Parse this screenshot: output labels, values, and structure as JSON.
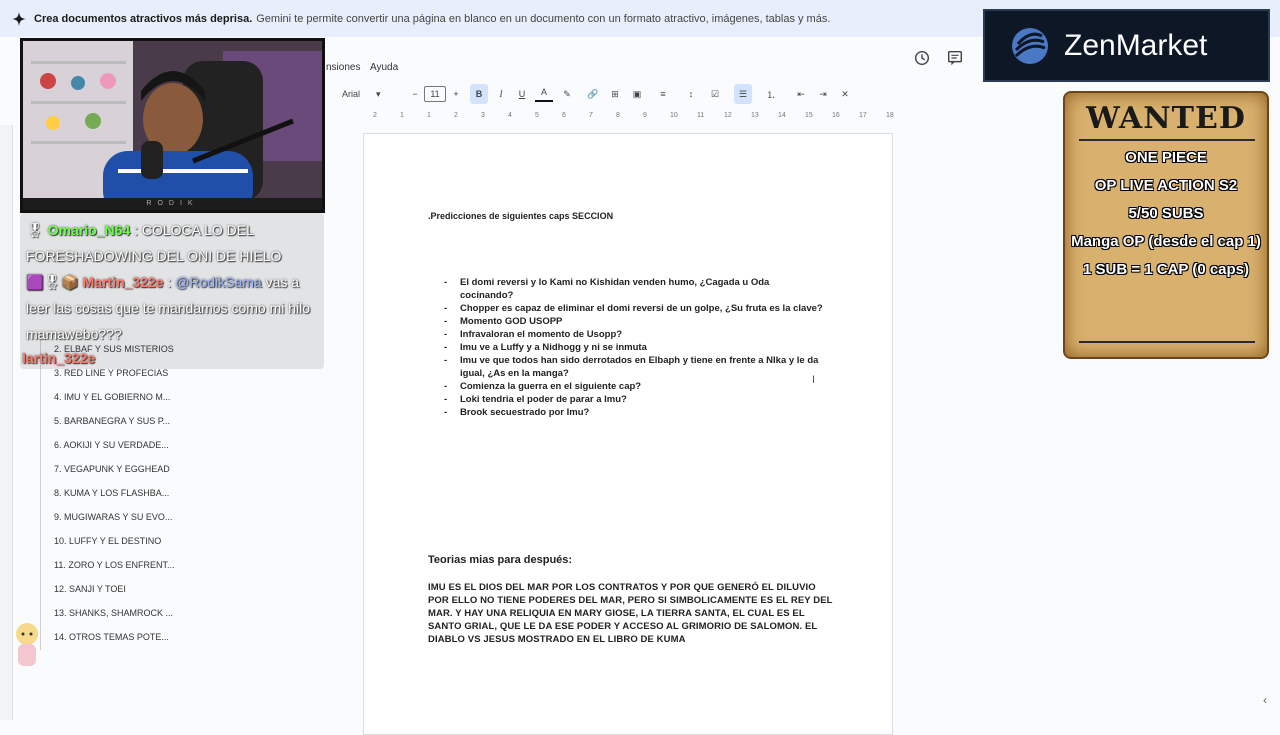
{
  "banner": {
    "bold": "Crea documentos atractivos más deprisa.",
    "rest": "Gemini te permite convertir una página en blanco en un documento con un formato atractivo, imágenes, tablas y más."
  },
  "menu": {
    "extensions": "nsiones",
    "help": "Ayuda"
  },
  "toolbar": {
    "font": "Arial",
    "size": "11"
  },
  "ruler": [
    "2",
    "1",
    "1",
    "2",
    "3",
    "4",
    "5",
    "6",
    "7",
    "8",
    "9",
    "10",
    "11",
    "12",
    "13",
    "14",
    "15",
    "16",
    "17",
    "18"
  ],
  "doc": {
    "title": ".Predicciones de siguientes caps SECCION",
    "bullets": [
      "El domi reversi y lo Kami no Kishidan venden humo, ¿Cagada u Oda cocinando?",
      "Chopper es capaz de eliminar el domi reversi de un golpe, ¿Su fruta es la clave?",
      "Momento GOD USOPP",
      "Infravaloran el momento de Usopp?",
      "Imu ve a Luffy y a Nidhogg y ni se inmuta",
      "Imu ve que todos han sido derrotados en Elbaph y tiene en frente a NIka y le da igual, ¿As en la manga?",
      "Comienza la guerra en el siguiente cap?",
      "Loki tendria el poder de parar a Imu?",
      "Brook secuestrado por Imu?"
    ],
    "theory_heading": "Teorias mias para después:",
    "theory_text": "IMU ES EL DIOS DEL MAR POR LOS CONTRATOS Y POR QUE GENERÓ EL DILUVIO POR ELLO NO TIENE PODERES DEL MAR, PERO SI SIMBOLICAMENTE ES EL REY DEL MAR. Y HAY UNA RELIQUIA EN MARY GIOSE, LA TIERRA SANTA, EL CUAL ES EL SANTO GRIAL, QUE LE DA ESE PODER Y ACCESO AL GRIMORIO DE SALOMON. EL DIABLO VS JESUS MOSTRADO EN EL LIBRO DE KUMA"
  },
  "outline": [
    "2. ELBAF Y SUS MISTERIOS",
    "3. RED LINE Y PROFECIAS",
    "4. IMU Y EL GOBIERNO M...",
    "5. BARBANEGRA Y SUS P...",
    "6. AOKIJI Y SU VERDADE...",
    "7. VEGAPUNK Y EGGHEAD",
    "8. KUMA Y LOS FLASHBA...",
    "9. MUGIWARAS Y SU EVO...",
    "10. LUFFY Y EL DESTINO",
    "11. ZORO Y LOS ENFRENT...",
    "12. SANJI Y TOEI",
    "13. SHANKS, SHAMROCK ...",
    "14. OTROS TEMAS POTE..."
  ],
  "stream": {
    "cam_caption": "RODIK",
    "chat": [
      {
        "user": "Omario_N64",
        "sep": " : ",
        "text": "COLOCA LO DEL FORESHADOWING DEL ONI DE HIELO"
      },
      {
        "user": "Martin_322e",
        "sep": " : ",
        "mention": "@RodikSama",
        "text": " vas a leer las cosas que te mandamos como mi hilo mamawebo???"
      }
    ],
    "chat_partial": "lartin_322e",
    "sponsor": "ZenMarket",
    "wanted": {
      "title": "WANTED",
      "lines": [
        "ONE PIECE",
        "OP LIVE ACTION S2",
        "5/50 SUBS",
        "Manga OP (desde el cap 1)",
        "1 SUB = 1 CAP (0 caps)"
      ]
    }
  },
  "colors": {
    "banner": "#e8eefb",
    "accent_green": "#6cff4a",
    "accent_red": "#ff7b6b",
    "zen_bg": "#0e1726",
    "poster": "#d9b16e"
  }
}
